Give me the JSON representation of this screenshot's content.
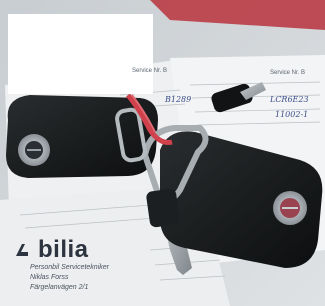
{
  "scene": {
    "subject": "keys",
    "colors": {
      "paper": "#eef0f1",
      "key_body": "#161819",
      "metal_blade": "#a7adb1",
      "lanyard": "#d0414c",
      "redaction": "#ffffff"
    }
  },
  "documents": {
    "left_header": "Service Nr. B",
    "right_header": "Service Nr. B",
    "brand_name": "bilia",
    "brand_sub_1": "Personbil Servicetekniker",
    "brand_sub_2": "Niklas Forss",
    "brand_sub_3": "Färgelanvägen 2/1",
    "handwriting_1": "B1289",
    "handwriting_2": "LCR6E23",
    "handwriting_3": "11002-1"
  }
}
